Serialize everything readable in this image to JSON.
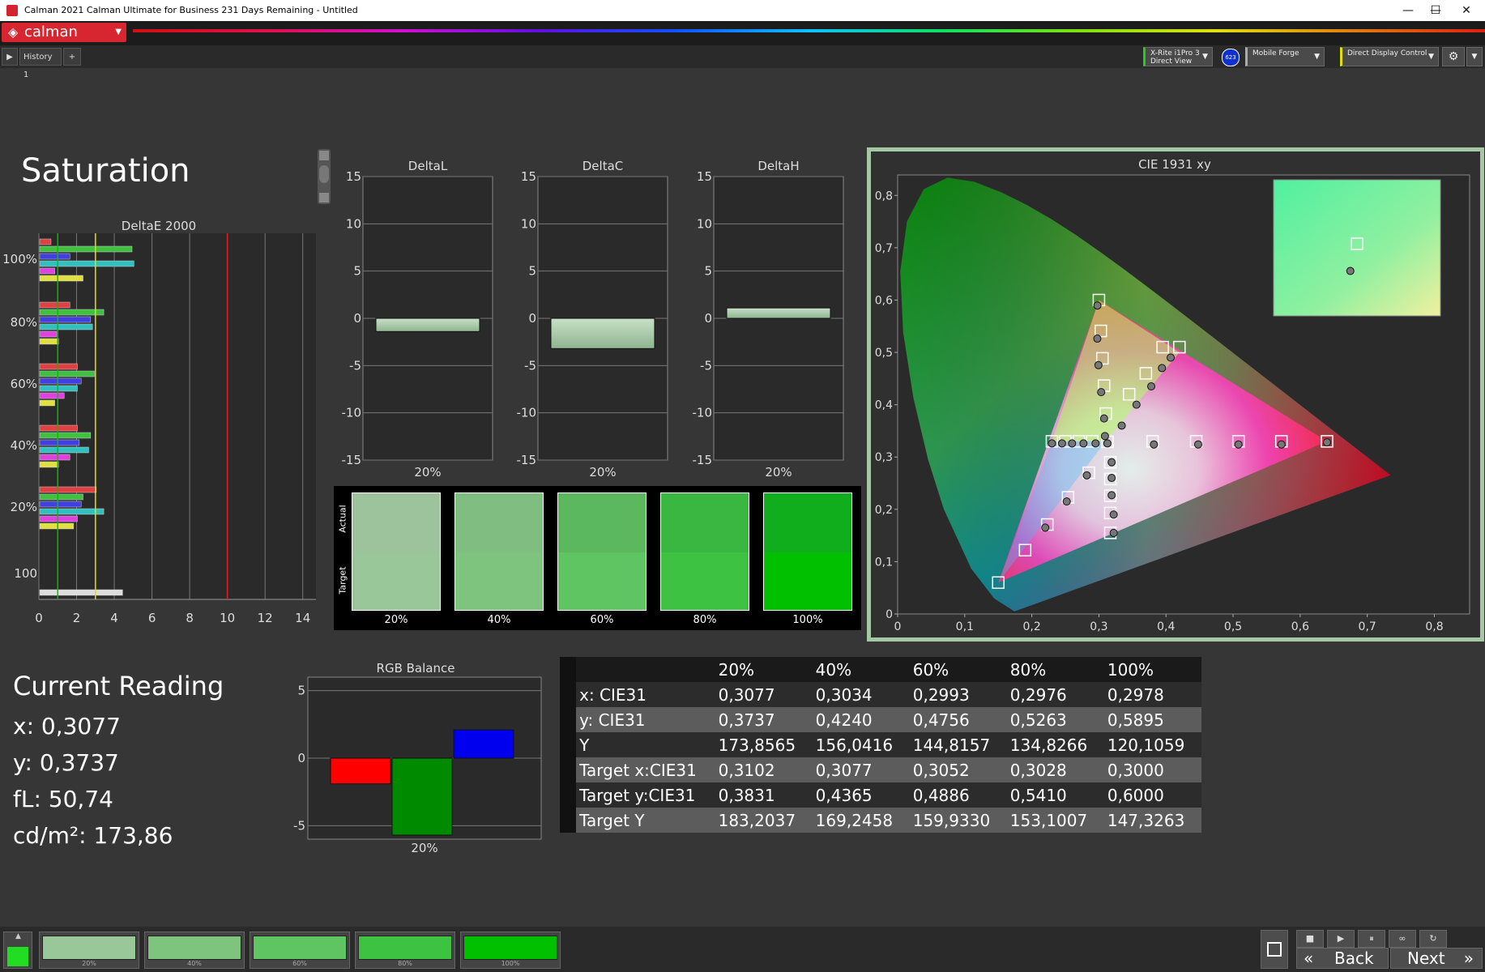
{
  "window": {
    "title": "Calman 2021 Calman Ultimate for Business 231 Days Remaining  - Untitled",
    "min": "—",
    "max": "☐",
    "close": "✕"
  },
  "menubar": {
    "logo": "calman",
    "logo_dropdown": "▼"
  },
  "tabbar": {
    "play": "▶",
    "tab": "History 1",
    "add": "+",
    "meter": {
      "line1": "X-Rite i1Pro 3",
      "line2": "Direct View",
      "badge": "623"
    },
    "source": "Mobile Forge",
    "display": "Direct Display Control",
    "arrow": "▼",
    "gear": "⚙",
    "more": "▼"
  },
  "page": {
    "title": "Saturation"
  },
  "deltae": {
    "title": "DeltaE 2000",
    "x_ticks": [
      "0",
      "2",
      "4",
      "6",
      "8",
      "10",
      "12",
      "14"
    ],
    "groups": [
      {
        "label": "100%",
        "values": [
          0.6,
          4.9,
          1.6,
          5.0,
          0.8,
          2.3
        ]
      },
      {
        "label": "80%",
        "values": [
          1.6,
          3.4,
          2.7,
          2.8,
          0.9,
          1.0
        ]
      },
      {
        "label": "60%",
        "values": [
          2.0,
          2.9,
          2.2,
          2.0,
          1.3,
          0.8
        ]
      },
      {
        "label": "40%",
        "values": [
          2.0,
          2.7,
          2.1,
          2.6,
          1.6,
          1.0
        ]
      },
      {
        "label": "20%",
        "values": [
          3.0,
          2.3,
          2.2,
          3.4,
          2.0,
          1.8
        ]
      },
      {
        "label": "100",
        "values": [
          4.4
        ]
      }
    ],
    "colors": [
      "#e04040",
      "#40c040",
      "#4040e0",
      "#30c0c0",
      "#e040e0",
      "#e0e040"
    ],
    "lines": [
      {
        "x": 1,
        "color": "#00c000"
      },
      {
        "x": 3,
        "color": "#e0e000"
      },
      {
        "x": 10,
        "color": "#e02020"
      }
    ]
  },
  "delta_charts": [
    {
      "title": "DeltaL",
      "value": -1.4,
      "xlabel": "20%"
    },
    {
      "title": "DeltaC",
      "value": -3.2,
      "xlabel": "20%"
    },
    {
      "title": "DeltaH",
      "value": 1.1,
      "xlabel": "20%"
    }
  ],
  "delta_ticks": [
    "15",
    "10",
    "5",
    "0",
    "-5",
    "-10",
    "-15"
  ],
  "swatches": {
    "actual_label": "Actual",
    "target_label": "Target",
    "items": [
      {
        "label": "20%",
        "actual": "#9dc39d",
        "target": "#9ac79a"
      },
      {
        "label": "40%",
        "actual": "#7fbd80",
        "target": "#7ec47f"
      },
      {
        "label": "60%",
        "actual": "#5cb85f",
        "target": "#5fc462"
      },
      {
        "label": "80%",
        "actual": "#3ab740",
        "target": "#3ec242"
      },
      {
        "label": "100%",
        "actual": "#10ae1c",
        "target": "#00c000"
      }
    ]
  },
  "cie": {
    "title": "CIE 1931 xy",
    "x_ticks": [
      "0",
      "0,1",
      "0,2",
      "0,3",
      "0,4",
      "0,5",
      "0,6",
      "0,7",
      "0,8"
    ],
    "y_ticks": [
      "0",
      "0,1",
      "0,2",
      "0,3",
      "0,4",
      "0,5",
      "0,6",
      "0,7",
      "0,8"
    ],
    "targets": [
      [
        0.3127,
        0.329
      ],
      [
        0.3102,
        0.3831
      ],
      [
        0.3077,
        0.4365
      ],
      [
        0.3052,
        0.4886
      ],
      [
        0.3028,
        0.541
      ],
      [
        0.3,
        0.6
      ],
      [
        0.38,
        0.33
      ],
      [
        0.445,
        0.33
      ],
      [
        0.508,
        0.33
      ],
      [
        0.572,
        0.33
      ],
      [
        0.64,
        0.33
      ],
      [
        0.317,
        0.155
      ],
      [
        0.317,
        0.193
      ],
      [
        0.317,
        0.226
      ],
      [
        0.317,
        0.258
      ],
      [
        0.317,
        0.29
      ],
      [
        0.285,
        0.27
      ],
      [
        0.254,
        0.223
      ],
      [
        0.223,
        0.171
      ],
      [
        0.19,
        0.122
      ],
      [
        0.15,
        0.06
      ],
      [
        0.23,
        0.33
      ],
      [
        0.25,
        0.33
      ],
      [
        0.27,
        0.33
      ],
      [
        0.29,
        0.33
      ],
      [
        0.345,
        0.42
      ],
      [
        0.37,
        0.46
      ],
      [
        0.395,
        0.51
      ],
      [
        0.42,
        0.51
      ]
    ],
    "actuals": [
      [
        0.3077,
        0.3737
      ],
      [
        0.3034,
        0.424
      ],
      [
        0.2993,
        0.4756
      ],
      [
        0.2976,
        0.5263
      ],
      [
        0.2978,
        0.5895
      ],
      [
        0.382,
        0.324
      ],
      [
        0.448,
        0.324
      ],
      [
        0.508,
        0.324
      ],
      [
        0.572,
        0.324
      ],
      [
        0.64,
        0.328
      ],
      [
        0.322,
        0.155
      ],
      [
        0.322,
        0.19
      ],
      [
        0.319,
        0.227
      ],
      [
        0.319,
        0.26
      ],
      [
        0.319,
        0.29
      ],
      [
        0.282,
        0.265
      ],
      [
        0.252,
        0.215
      ],
      [
        0.22,
        0.165
      ],
      [
        0.23,
        0.326
      ],
      [
        0.245,
        0.326
      ],
      [
        0.26,
        0.326
      ],
      [
        0.277,
        0.326
      ],
      [
        0.295,
        0.326
      ],
      [
        0.3127,
        0.326
      ],
      [
        0.309,
        0.34
      ],
      [
        0.334,
        0.36
      ],
      [
        0.356,
        0.4
      ],
      [
        0.378,
        0.435
      ],
      [
        0.394,
        0.47
      ],
      [
        0.407,
        0.49
      ]
    ],
    "inset_target": [
      0.5,
      0.47
    ],
    "inset_actual": [
      0.46,
      0.67
    ]
  },
  "current_reading": {
    "title": "Current Reading",
    "x": "x: 0,3077",
    "y": "y: 0,3737",
    "fl": "fL: 50,74",
    "cdm2": "cd/m²: 173,86"
  },
  "rgb_balance": {
    "title": "RGB Balance",
    "y_ticks": [
      "5",
      "0",
      "-5"
    ],
    "xlabel": "20%",
    "values": [
      {
        "channel": "red",
        "value": -1.9,
        "color": "#ff0000"
      },
      {
        "channel": "green",
        "value": -5.7,
        "color": "#008a00"
      },
      {
        "channel": "blue",
        "value": 2.1,
        "color": "#0000ee"
      }
    ]
  },
  "table": {
    "columns": [
      "20%",
      "40%",
      "60%",
      "80%",
      "100%"
    ],
    "rows": [
      {
        "label": "x: CIE31",
        "values": [
          "0,3077",
          "0,3034",
          "0,2993",
          "0,2976",
          "0,2978"
        ]
      },
      {
        "label": "y: CIE31",
        "values": [
          "0,3737",
          "0,4240",
          "0,4756",
          "0,5263",
          "0,5895"
        ]
      },
      {
        "label": "Y",
        "values": [
          "173,8565",
          "156,0416",
          "144,8157",
          "134,8266",
          "120,1059"
        ]
      },
      {
        "label": "Target x:CIE31",
        "values": [
          "0,3102",
          "0,3077",
          "0,3052",
          "0,3028",
          "0,3000"
        ]
      },
      {
        "label": "Target y:CIE31",
        "values": [
          "0,3831",
          "0,4365",
          "0,4886",
          "0,5410",
          "0,6000"
        ]
      },
      {
        "label": "Target Y",
        "values": [
          "183,2037",
          "169,2458",
          "159,9330",
          "153,1007",
          "147,3263"
        ]
      }
    ]
  },
  "bottom": {
    "current_color": "#22dd22",
    "patches": [
      {
        "label": "20%",
        "color": "#9ac79a"
      },
      {
        "label": "40%",
        "color": "#7ec47f"
      },
      {
        "label": "60%",
        "color": "#5fc462"
      },
      {
        "label": "80%",
        "color": "#3ec242"
      },
      {
        "label": "100%",
        "color": "#00c000"
      }
    ],
    "controls": [
      "■",
      "▶",
      "⏸",
      "∞",
      "↻"
    ],
    "back": "Back",
    "next": "Next",
    "back_icon": "«",
    "next_icon": "»"
  }
}
